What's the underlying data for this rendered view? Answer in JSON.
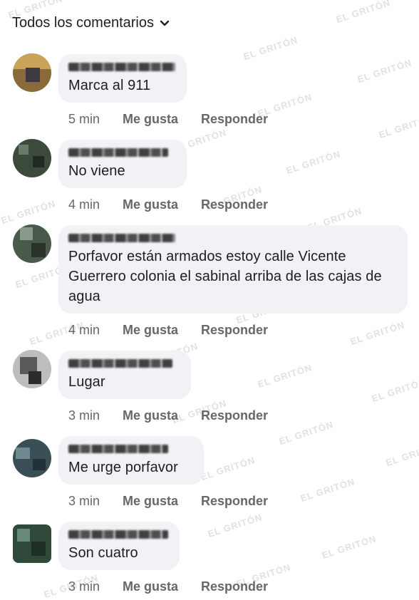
{
  "header": {
    "filter_label": "Todos los comentarios"
  },
  "watermark": "EL GRITÓN",
  "actions": {
    "like": "Me gusta",
    "reply": "Responder"
  },
  "comments": [
    {
      "text": "Marca al 911",
      "time": "5 min",
      "avatar_colors": [
        "#8a6a3a",
        "#c9a35a",
        "#3a3a40"
      ]
    },
    {
      "text": "No viene",
      "time": "4 min",
      "avatar_colors": [
        "#3c4a3c",
        "#6a7a6a",
        "#1e2a22"
      ]
    },
    {
      "text": "Porfavor están armados estoy calle Vicente Guerrero colonia el sabinal arriba de las cajas de agua",
      "time": "4 min",
      "avatar_colors": [
        "#4a5a4a",
        "#8a9a8a",
        "#2a332a"
      ]
    },
    {
      "text": "Lugar",
      "time": "3 min",
      "avatar_colors": [
        "#5a5a5a",
        "#bdbdbd",
        "#2c2c2c"
      ]
    },
    {
      "text": "Me urge porfavor",
      "time": "3 min",
      "avatar_colors": [
        "#3a4f55",
        "#6c8a90",
        "#22323a"
      ]
    },
    {
      "text": "Son cuatro",
      "time": "3 min",
      "avatar_colors": [
        "#2f4a3a",
        "#6a8a78",
        "#1d2f26"
      ]
    }
  ]
}
